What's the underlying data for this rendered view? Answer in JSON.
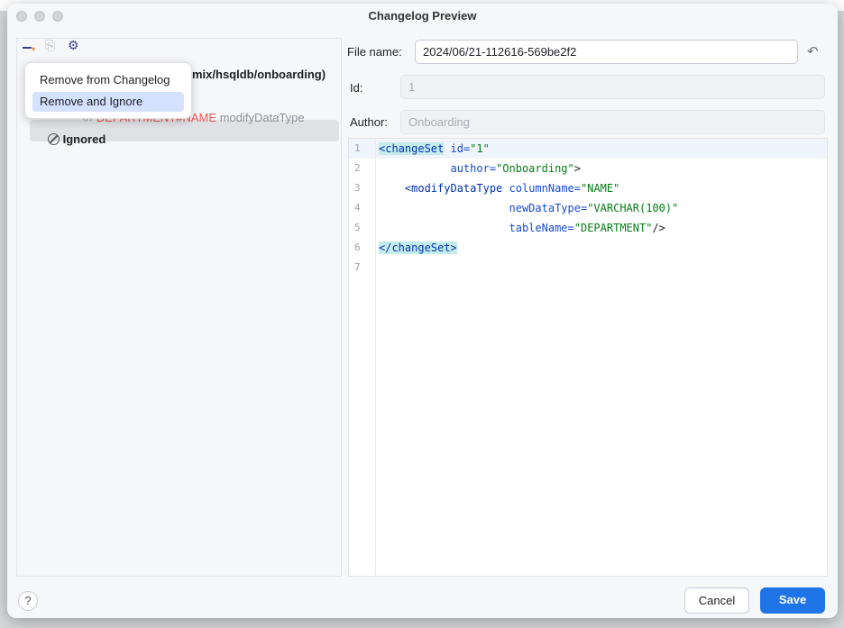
{
  "window": {
    "title": "Changelog Preview"
  },
  "toolbar": {
    "remove_icon": "minus-dropdown-icon",
    "move_icon": "move-to-changelog-icon",
    "settings_icon": "gear-dropdown-icon"
  },
  "popup": {
    "items": [
      {
        "label": "Remove from Changelog"
      },
      {
        "label": "Remove and Ignore",
        "highlighted": true
      }
    ]
  },
  "tree": {
    "root": "mix/hsqldb/onboarding)",
    "change_name": "DEPARTMENT#NAME",
    "change_type": "modifyDataType",
    "ignored": "Ignored"
  },
  "form": {
    "file_name_label": "File name:",
    "file_name_value": "2024/06/21-112616-569be2f2",
    "id_label": "Id:",
    "id_value": "1",
    "author_label": "Author:",
    "author_value": "Onboarding"
  },
  "editor": {
    "line_numbers": [
      "1",
      "2",
      "3",
      "4",
      "5",
      "6",
      "7"
    ]
  },
  "footer": {
    "help": "?",
    "cancel": "Cancel",
    "save": "Save"
  },
  "colors": {
    "accent": "#1f74e8",
    "selection": "#d4e2ff",
    "error_text": "#f0524f"
  }
}
